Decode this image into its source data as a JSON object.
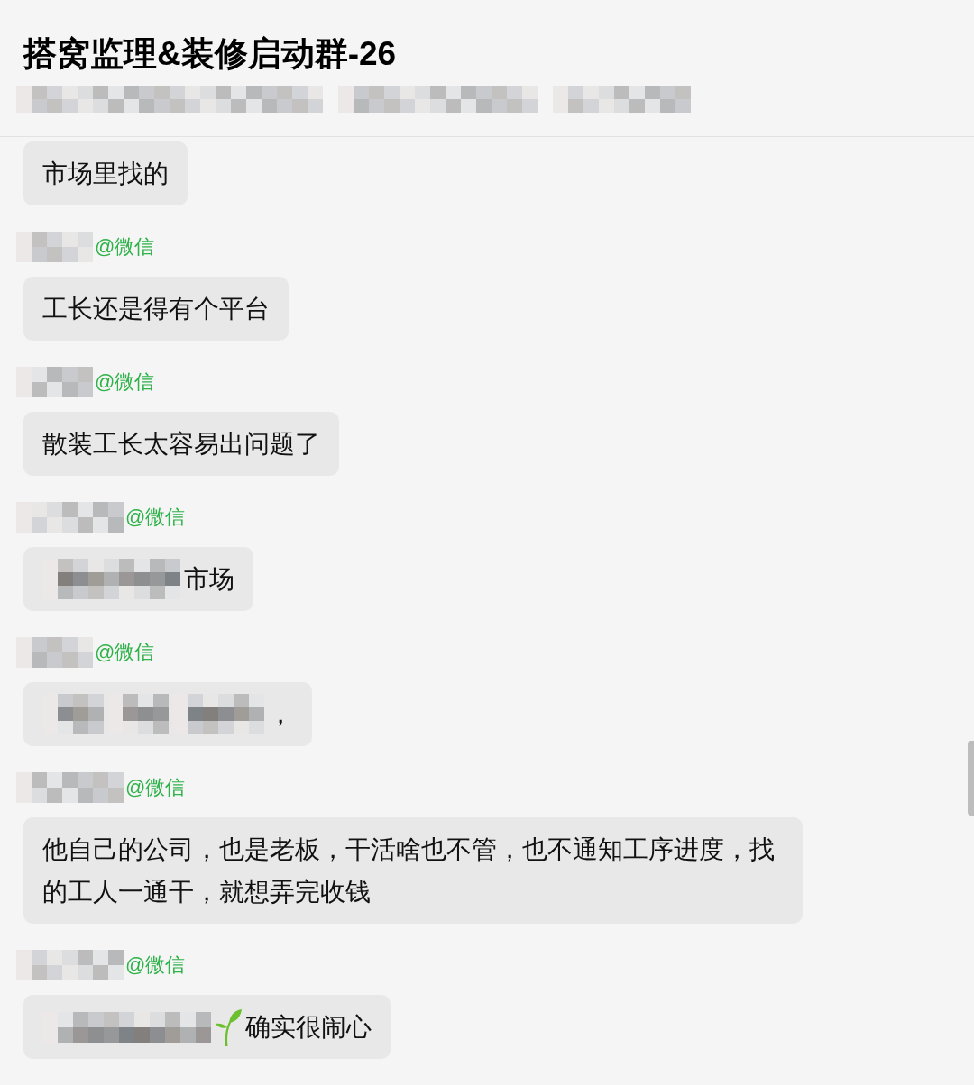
{
  "header": {
    "title": "搭窝监理&装修启动群-26"
  },
  "messages": [
    {
      "parts": [
        {
          "kind": "text",
          "text": "市场里找的"
        }
      ]
    },
    {
      "sender": {
        "label": "@微信"
      },
      "parts": [
        {
          "kind": "text",
          "text": "工长还是得有个平台"
        }
      ]
    },
    {
      "sender": {
        "label": "@微信"
      },
      "parts": [
        {
          "kind": "text",
          "text": "散装工长太容易出问题了"
        }
      ]
    },
    {
      "sender": {
        "label": "@微信"
      },
      "parts": [
        {
          "kind": "redacted"
        },
        {
          "kind": "text",
          "text": "市场"
        }
      ]
    },
    {
      "sender": {
        "label": "@微信"
      },
      "parts": [
        {
          "kind": "redacted"
        },
        {
          "kind": "redacted"
        },
        {
          "kind": "redacted"
        },
        {
          "kind": "text",
          "text": "，"
        }
      ]
    },
    {
      "sender": {
        "label": "@微信"
      },
      "parts": [
        {
          "kind": "text",
          "text": "他自己的公司，也是老板，干活啥也不管，也不通知工序进度，找的工人一通干，就想弄完收钱"
        }
      ]
    },
    {
      "sender": {
        "label": "@微信"
      },
      "parts": [
        {
          "kind": "redacted"
        },
        {
          "kind": "sprout"
        },
        {
          "kind": "text",
          "text": "确实很闹心"
        }
      ]
    }
  ]
}
